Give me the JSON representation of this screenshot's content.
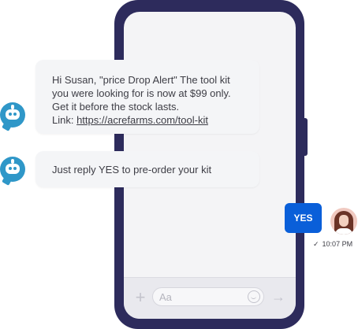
{
  "messages": {
    "bot_1": {
      "line1": "Hi Susan, \"price Drop Alert\" The tool kit",
      "line2": "you were looking for is now at $99 only.",
      "line3": "Get it before the stock lasts.",
      "link_prefix": "Link: ",
      "link_text": "https://acrefarms.com/tool-kit"
    },
    "bot_2": {
      "text": "Just reply YES to pre-order your kit"
    },
    "user_reply": {
      "text": "YES",
      "time": "10:07 PM",
      "check": "✓"
    }
  },
  "composer": {
    "placeholder": "Aa",
    "plus_glyph": "+",
    "send_glyph": "→"
  },
  "colors": {
    "phone_frame": "#2d2b5c",
    "bot_accent": "#2f97c8",
    "reply_bubble": "#0a5fd9"
  },
  "icons": [
    "bot-icon",
    "user-avatar",
    "plus-icon",
    "emoji-icon",
    "send-arrow-icon",
    "check-icon"
  ]
}
